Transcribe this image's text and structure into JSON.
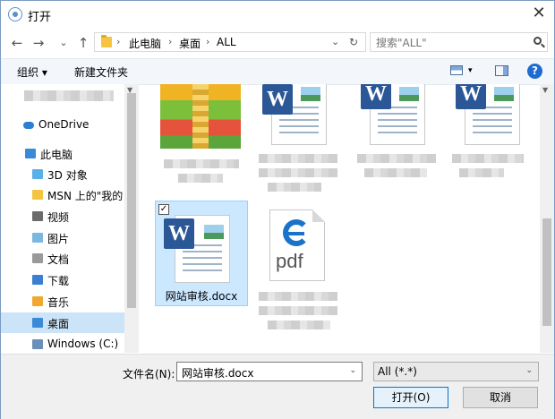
{
  "title": "打开",
  "nav": {
    "back": "←",
    "forward": "→",
    "recent": "⌄",
    "up": "↑",
    "breadcrumb": [
      "此电脑",
      "桌面",
      "ALL"
    ],
    "refresh": "↻",
    "address_dropdown": "⌄"
  },
  "search": {
    "placeholder": "搜索\"ALL\""
  },
  "toolbar": {
    "organize": "组织 ▾",
    "new_folder": "新建文件夹",
    "help": "?"
  },
  "sidebar": {
    "items": [
      {
        "label": "OneDrive",
        "icon": "cloud-icon"
      },
      {
        "label": "此电脑",
        "icon": "computer-icon"
      },
      {
        "label": "3D 对象",
        "icon": "cube-icon"
      },
      {
        "label": "MSN 上的\"我的",
        "icon": "folder-icon"
      },
      {
        "label": "视频",
        "icon": "video-folder-icon"
      },
      {
        "label": "图片",
        "icon": "picture-folder-icon"
      },
      {
        "label": "文档",
        "icon": "documents-folder-icon"
      },
      {
        "label": "下载",
        "icon": "download-folder-icon"
      },
      {
        "label": "音乐",
        "icon": "music-folder-icon"
      },
      {
        "label": "桌面",
        "icon": "desktop-folder-icon",
        "selected": true
      },
      {
        "label": "Windows (C:)",
        "icon": "drive-icon"
      }
    ]
  },
  "files": {
    "selected_name": "网站审核.docx",
    "pdf_label": "pdf",
    "word_badge": "W"
  },
  "bottom": {
    "filename_label": "文件名(N):",
    "filename_value": "网站审核.docx",
    "filetype_value": "All (*.*)",
    "open_button": "打开(O)",
    "cancel_button": "取消"
  },
  "colors": {
    "accent": "#0078d7",
    "selection": "#cce8ff",
    "help": "#1f6bd0"
  }
}
